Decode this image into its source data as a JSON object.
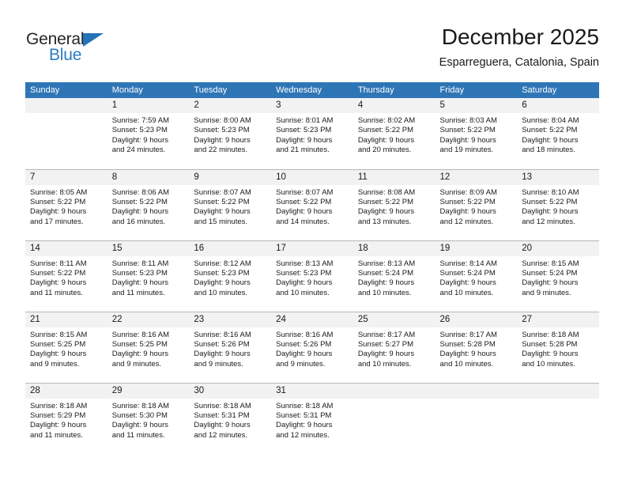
{
  "logo": {
    "word_top": "General",
    "word_bottom": "Blue",
    "triangle_icon": "triangle-icon",
    "colors": {
      "dark": "#262626",
      "blue": "#2b7cc4"
    }
  },
  "header": {
    "month_title": "December 2025",
    "location": "Esparreguera, Catalonia, Spain"
  },
  "theme": {
    "header_blue": "#2e75b6",
    "daynum_band": "#f2f2f2",
    "row_divider": "#b7b7b7"
  },
  "calendar": {
    "weekdays": [
      "Sunday",
      "Monday",
      "Tuesday",
      "Wednesday",
      "Thursday",
      "Friday",
      "Saturday"
    ],
    "weeks": [
      [
        {
          "day": "",
          "sunrise": "",
          "sunset": "",
          "daylight1": "",
          "daylight2": ""
        },
        {
          "day": "1",
          "sunrise": "Sunrise: 7:59 AM",
          "sunset": "Sunset: 5:23 PM",
          "daylight1": "Daylight: 9 hours",
          "daylight2": "and 24 minutes."
        },
        {
          "day": "2",
          "sunrise": "Sunrise: 8:00 AM",
          "sunset": "Sunset: 5:23 PM",
          "daylight1": "Daylight: 9 hours",
          "daylight2": "and 22 minutes."
        },
        {
          "day": "3",
          "sunrise": "Sunrise: 8:01 AM",
          "sunset": "Sunset: 5:23 PM",
          "daylight1": "Daylight: 9 hours",
          "daylight2": "and 21 minutes."
        },
        {
          "day": "4",
          "sunrise": "Sunrise: 8:02 AM",
          "sunset": "Sunset: 5:22 PM",
          "daylight1": "Daylight: 9 hours",
          "daylight2": "and 20 minutes."
        },
        {
          "day": "5",
          "sunrise": "Sunrise: 8:03 AM",
          "sunset": "Sunset: 5:22 PM",
          "daylight1": "Daylight: 9 hours",
          "daylight2": "and 19 minutes."
        },
        {
          "day": "6",
          "sunrise": "Sunrise: 8:04 AM",
          "sunset": "Sunset: 5:22 PM",
          "daylight1": "Daylight: 9 hours",
          "daylight2": "and 18 minutes."
        }
      ],
      [
        {
          "day": "7",
          "sunrise": "Sunrise: 8:05 AM",
          "sunset": "Sunset: 5:22 PM",
          "daylight1": "Daylight: 9 hours",
          "daylight2": "and 17 minutes."
        },
        {
          "day": "8",
          "sunrise": "Sunrise: 8:06 AM",
          "sunset": "Sunset: 5:22 PM",
          "daylight1": "Daylight: 9 hours",
          "daylight2": "and 16 minutes."
        },
        {
          "day": "9",
          "sunrise": "Sunrise: 8:07 AM",
          "sunset": "Sunset: 5:22 PM",
          "daylight1": "Daylight: 9 hours",
          "daylight2": "and 15 minutes."
        },
        {
          "day": "10",
          "sunrise": "Sunrise: 8:07 AM",
          "sunset": "Sunset: 5:22 PM",
          "daylight1": "Daylight: 9 hours",
          "daylight2": "and 14 minutes."
        },
        {
          "day": "11",
          "sunrise": "Sunrise: 8:08 AM",
          "sunset": "Sunset: 5:22 PM",
          "daylight1": "Daylight: 9 hours",
          "daylight2": "and 13 minutes."
        },
        {
          "day": "12",
          "sunrise": "Sunrise: 8:09 AM",
          "sunset": "Sunset: 5:22 PM",
          "daylight1": "Daylight: 9 hours",
          "daylight2": "and 12 minutes."
        },
        {
          "day": "13",
          "sunrise": "Sunrise: 8:10 AM",
          "sunset": "Sunset: 5:22 PM",
          "daylight1": "Daylight: 9 hours",
          "daylight2": "and 12 minutes."
        }
      ],
      [
        {
          "day": "14",
          "sunrise": "Sunrise: 8:11 AM",
          "sunset": "Sunset: 5:22 PM",
          "daylight1": "Daylight: 9 hours",
          "daylight2": "and 11 minutes."
        },
        {
          "day": "15",
          "sunrise": "Sunrise: 8:11 AM",
          "sunset": "Sunset: 5:23 PM",
          "daylight1": "Daylight: 9 hours",
          "daylight2": "and 11 minutes."
        },
        {
          "day": "16",
          "sunrise": "Sunrise: 8:12 AM",
          "sunset": "Sunset: 5:23 PM",
          "daylight1": "Daylight: 9 hours",
          "daylight2": "and 10 minutes."
        },
        {
          "day": "17",
          "sunrise": "Sunrise: 8:13 AM",
          "sunset": "Sunset: 5:23 PM",
          "daylight1": "Daylight: 9 hours",
          "daylight2": "and 10 minutes."
        },
        {
          "day": "18",
          "sunrise": "Sunrise: 8:13 AM",
          "sunset": "Sunset: 5:24 PM",
          "daylight1": "Daylight: 9 hours",
          "daylight2": "and 10 minutes."
        },
        {
          "day": "19",
          "sunrise": "Sunrise: 8:14 AM",
          "sunset": "Sunset: 5:24 PM",
          "daylight1": "Daylight: 9 hours",
          "daylight2": "and 10 minutes."
        },
        {
          "day": "20",
          "sunrise": "Sunrise: 8:15 AM",
          "sunset": "Sunset: 5:24 PM",
          "daylight1": "Daylight: 9 hours",
          "daylight2": "and 9 minutes."
        }
      ],
      [
        {
          "day": "21",
          "sunrise": "Sunrise: 8:15 AM",
          "sunset": "Sunset: 5:25 PM",
          "daylight1": "Daylight: 9 hours",
          "daylight2": "and 9 minutes."
        },
        {
          "day": "22",
          "sunrise": "Sunrise: 8:16 AM",
          "sunset": "Sunset: 5:25 PM",
          "daylight1": "Daylight: 9 hours",
          "daylight2": "and 9 minutes."
        },
        {
          "day": "23",
          "sunrise": "Sunrise: 8:16 AM",
          "sunset": "Sunset: 5:26 PM",
          "daylight1": "Daylight: 9 hours",
          "daylight2": "and 9 minutes."
        },
        {
          "day": "24",
          "sunrise": "Sunrise: 8:16 AM",
          "sunset": "Sunset: 5:26 PM",
          "daylight1": "Daylight: 9 hours",
          "daylight2": "and 9 minutes."
        },
        {
          "day": "25",
          "sunrise": "Sunrise: 8:17 AM",
          "sunset": "Sunset: 5:27 PM",
          "daylight1": "Daylight: 9 hours",
          "daylight2": "and 10 minutes."
        },
        {
          "day": "26",
          "sunrise": "Sunrise: 8:17 AM",
          "sunset": "Sunset: 5:28 PM",
          "daylight1": "Daylight: 9 hours",
          "daylight2": "and 10 minutes."
        },
        {
          "day": "27",
          "sunrise": "Sunrise: 8:18 AM",
          "sunset": "Sunset: 5:28 PM",
          "daylight1": "Daylight: 9 hours",
          "daylight2": "and 10 minutes."
        }
      ],
      [
        {
          "day": "28",
          "sunrise": "Sunrise: 8:18 AM",
          "sunset": "Sunset: 5:29 PM",
          "daylight1": "Daylight: 9 hours",
          "daylight2": "and 11 minutes."
        },
        {
          "day": "29",
          "sunrise": "Sunrise: 8:18 AM",
          "sunset": "Sunset: 5:30 PM",
          "daylight1": "Daylight: 9 hours",
          "daylight2": "and 11 minutes."
        },
        {
          "day": "30",
          "sunrise": "Sunrise: 8:18 AM",
          "sunset": "Sunset: 5:31 PM",
          "daylight1": "Daylight: 9 hours",
          "daylight2": "and 12 minutes."
        },
        {
          "day": "31",
          "sunrise": "Sunrise: 8:18 AM",
          "sunset": "Sunset: 5:31 PM",
          "daylight1": "Daylight: 9 hours",
          "daylight2": "and 12 minutes."
        },
        {
          "day": "",
          "sunrise": "",
          "sunset": "",
          "daylight1": "",
          "daylight2": ""
        },
        {
          "day": "",
          "sunrise": "",
          "sunset": "",
          "daylight1": "",
          "daylight2": ""
        },
        {
          "day": "",
          "sunrise": "",
          "sunset": "",
          "daylight1": "",
          "daylight2": ""
        }
      ]
    ]
  }
}
